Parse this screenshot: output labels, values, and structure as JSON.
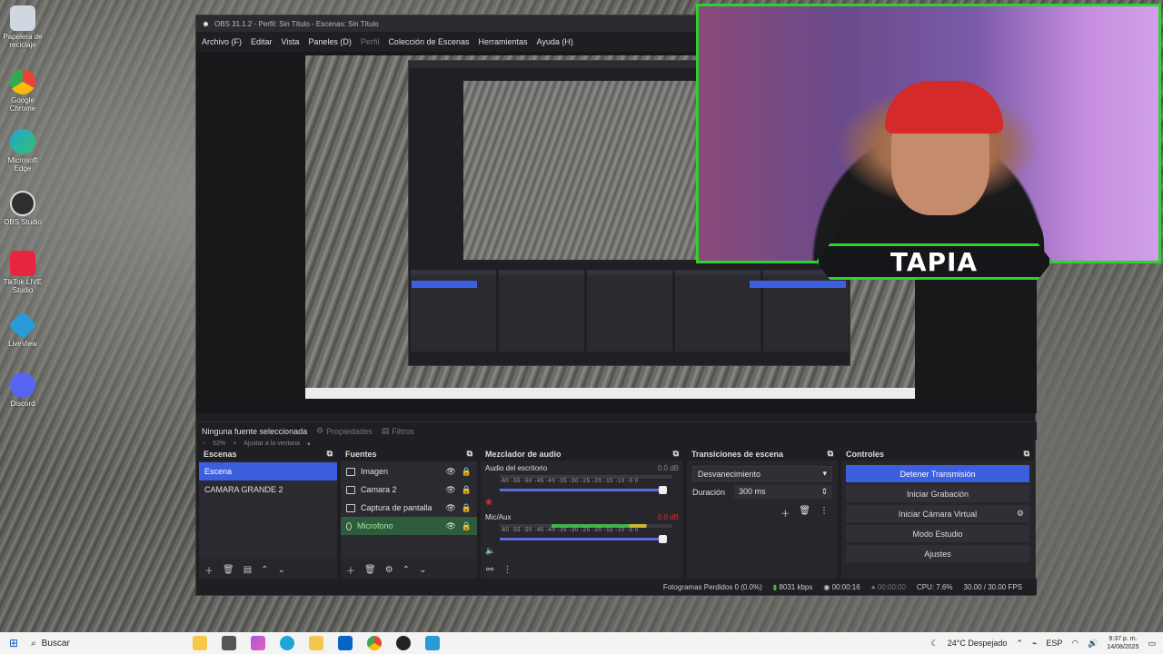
{
  "desktop": {
    "icons": [
      {
        "label": "Papelera de reciclaje",
        "icon": "recycle-bin-icon",
        "color": "#cfd8e0"
      },
      {
        "label": "Google Chrome",
        "icon": "chrome-icon",
        "color": "#4285f4"
      },
      {
        "label": "Microsoft Edge",
        "icon": "edge-icon",
        "color": "#1fa5d6"
      },
      {
        "label": "OBS Studio",
        "icon": "obs-icon",
        "color": "#302e31"
      },
      {
        "label": "TikTok LIVE Studio",
        "icon": "tiktok-icon",
        "color": "#e8253f"
      },
      {
        "label": "LiveView",
        "icon": "liveview-icon",
        "color": "#2a9bd8"
      },
      {
        "label": "Discord",
        "icon": "discord-icon",
        "color": "#5865f2"
      }
    ]
  },
  "obs": {
    "title": "OBS 31.1.2 - Perfil: Sin Título - Escenas: Sin Título",
    "menu": [
      "Archivo (F)",
      "Editar",
      "Vista",
      "Paneles (D)",
      "Perfil",
      "Colección de Escenas",
      "Herramientas",
      "Ayuda (H)"
    ],
    "zoom": {
      "value": "52%",
      "fit_label": "Ajustar a la ventana"
    },
    "source_bar": {
      "no_source": "Ninguna fuente seleccionada",
      "properties": "Propiedades",
      "filters": "Filtros"
    },
    "scenes": {
      "title": "Escenas",
      "items": [
        "Escena",
        "CAMARA GRANDE 2"
      ]
    },
    "sources": {
      "title": "Fuentes",
      "items": [
        "Imagen",
        "Camara 2",
        "Captura de pantalla",
        "Microfono"
      ]
    },
    "mixer": {
      "title": "Mezclador de audio",
      "scale": "-60 -55 -50 -45 -40 -35 -30 -25 -20 -15 -10 -5 0",
      "tracks": [
        {
          "name": "Audio del escritorio",
          "db": "0.0 dB"
        },
        {
          "name": "Mic/Aux",
          "db": "0.0 dB"
        }
      ]
    },
    "transitions": {
      "title": "Transiciones de escena",
      "selected": "Desvanecimiento",
      "duration_label": "Duración",
      "duration_value": "300 ms"
    },
    "controls": {
      "title": "Controles",
      "stop_stream": "Detener Transmisión",
      "start_recording": "Iniciar Grabación",
      "virtual_cam": "Iniciar Cámara Virtual",
      "studio_mode": "Modo Estudio",
      "settings": "Ajustes"
    },
    "status": {
      "dropped": "Fotogramas Perdidos 0 (0.0%)",
      "bitrate": "8031 kbps",
      "stream_time": "00:00:16",
      "rec_time": "00:00:00",
      "cpu": "CPU: 7.6%",
      "fps": "30.00 / 30.00 FPS"
    }
  },
  "webcam": {
    "nameplate": "TAPIA",
    "border_color": "#2fd12f"
  },
  "taskbar": {
    "search": "Buscar",
    "weather": "24°C Despejado",
    "lang": "ESP",
    "time": "9:37 p. m.",
    "date": "14/08/2025"
  }
}
